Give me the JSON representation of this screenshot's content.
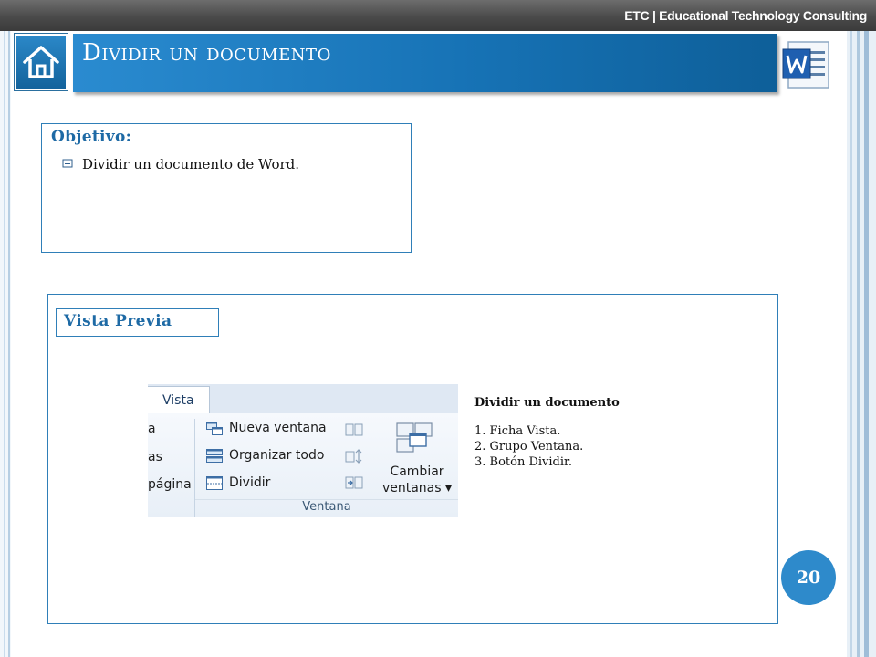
{
  "header": {
    "brand": "ETC | Educational Technology Consulting",
    "title": "Dividir un documento"
  },
  "objective": {
    "title": "Objetivo:",
    "items": [
      "Dividir un documento de Word."
    ]
  },
  "preview": {
    "label": "Vista Previa",
    "ribbon": {
      "tab": "Vista",
      "cut_items": [
        "a",
        "as",
        "página"
      ],
      "commands": [
        "Nueva ventana",
        "Organizar todo",
        "Dividir"
      ],
      "big_button_line1": "Cambiar",
      "big_button_line2": "ventanas ▾",
      "group_label": "Ventana"
    },
    "instructions": {
      "title": "Dividir un documento",
      "steps": [
        "1.  Ficha Vista.",
        "2.  Grupo  Ventana.",
        "3.  Botón Dividir."
      ]
    }
  },
  "page_number": "20",
  "colors": {
    "accent": "#1e6aa5",
    "title_bar": "#1773b6",
    "page_badge": "#2e8acb"
  },
  "icons": [
    "home-icon",
    "word-logo-icon",
    "bullet-icon"
  ]
}
